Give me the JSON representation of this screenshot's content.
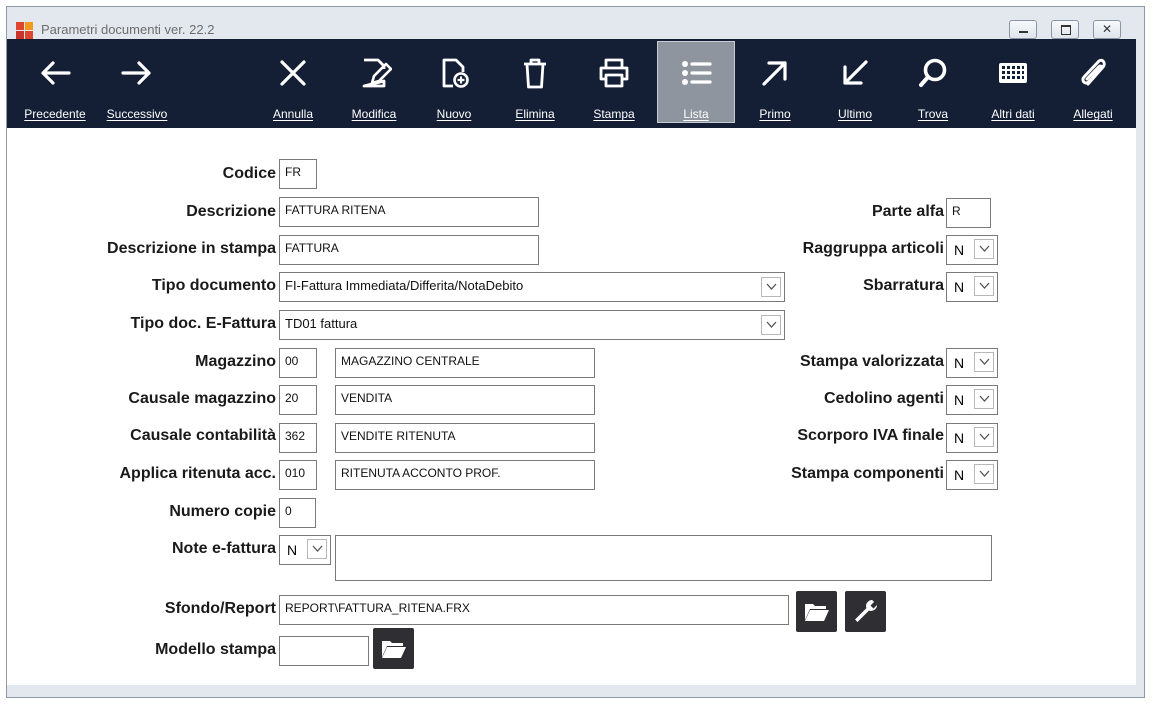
{
  "window": {
    "title": "Parametri documenti  ver. 22.2"
  },
  "toolbar": [
    {
      "label": "Precedente",
      "icon": "arrow-left-icon"
    },
    {
      "label": "Successivo",
      "icon": "arrow-right-icon"
    },
    {
      "label": "Annulla",
      "icon": "close-icon"
    },
    {
      "label": "Modifica",
      "icon": "edit-icon"
    },
    {
      "label": "Nuovo",
      "icon": "new-document-icon"
    },
    {
      "label": "Elimina",
      "icon": "trash-icon"
    },
    {
      "label": "Stampa",
      "icon": "printer-icon"
    },
    {
      "label": "Lista",
      "icon": "list-icon"
    },
    {
      "label": "Primo",
      "icon": "arrow-up-right-icon"
    },
    {
      "label": "Ultimo",
      "icon": "arrow-down-left-icon"
    },
    {
      "label": "Trova",
      "icon": "search-icon"
    },
    {
      "label": "Altri dati",
      "icon": "keypad-icon"
    },
    {
      "label": "Allegati",
      "icon": "paperclip-icon"
    }
  ],
  "form": {
    "codice": {
      "label": "Codice",
      "value": "FR"
    },
    "descrizione": {
      "label": "Descrizione",
      "value": "FATTURA RITENA"
    },
    "descrizione_stampa": {
      "label": "Descrizione in stampa",
      "value": "FATTURA"
    },
    "tipo_documento": {
      "label": "Tipo documento",
      "value": "FI-Fattura Immediata/Differita/NotaDebito"
    },
    "tipo_doc_efattura": {
      "label": "Tipo doc. E-Fattura",
      "value": "TD01 fattura"
    },
    "magazzino": {
      "label": "Magazzino",
      "code": "00",
      "desc": "MAGAZZINO CENTRALE"
    },
    "causale_magazzino": {
      "label": "Causale magazzino",
      "code": "20",
      "desc": "VENDITA"
    },
    "causale_contabilita": {
      "label": "Causale contabilità",
      "code": "362",
      "desc": "VENDITE RITENUTA"
    },
    "applica_ritenuta": {
      "label": "Applica ritenuta acc.",
      "code": "010",
      "desc": "RITENUTA ACCONTO PROF."
    },
    "numero_copie": {
      "label": "Numero copie",
      "value": "0"
    },
    "note_efattura": {
      "label": "Note e-fattura",
      "value": "N",
      "text": ""
    },
    "sfondo_report": {
      "label": "Sfondo/Report",
      "value": "REPORT\\FATTURA_RITENA.FRX"
    },
    "modello_stampa": {
      "label": "Modello stampa",
      "value": ""
    },
    "parte_alfa": {
      "label": "Parte alfa",
      "value": "R"
    },
    "raggruppa_articoli": {
      "label": "Raggruppa articoli",
      "value": "N"
    },
    "sbarratura": {
      "label": "Sbarratura",
      "value": "N"
    },
    "stampa_valorizzata": {
      "label": "Stampa valorizzata",
      "value": "N"
    },
    "cedolino_agenti": {
      "label": "Cedolino agenti",
      "value": "N"
    },
    "scorporo_iva": {
      "label": "Scorporo IVA finale",
      "value": "N"
    },
    "stampa_componenti": {
      "label": "Stampa componenti",
      "value": "N"
    }
  }
}
